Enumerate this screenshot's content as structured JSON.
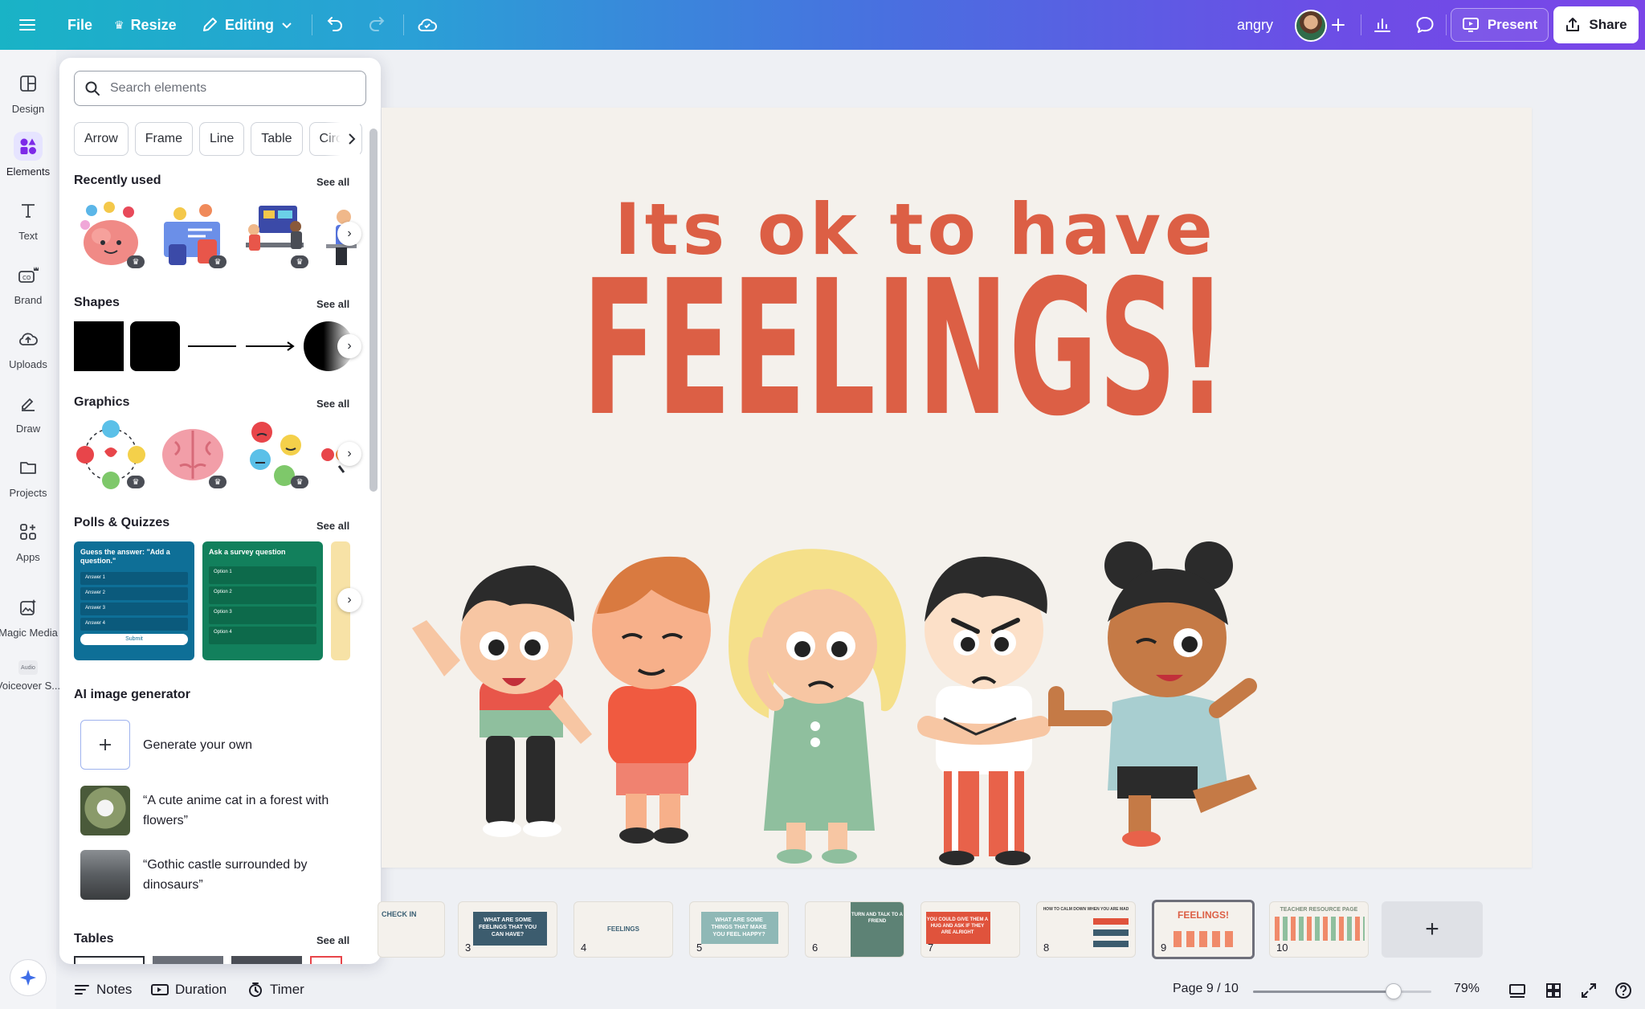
{
  "topbar": {
    "file_label": "File",
    "resize_label": "Resize",
    "editing_label": "Editing",
    "doc_title": "angry",
    "present_label": "Present",
    "share_label": "Share"
  },
  "rail": {
    "items": [
      {
        "label": "Design",
        "icon": "layout-icon"
      },
      {
        "label": "Elements",
        "icon": "elements-icon"
      },
      {
        "label": "Text",
        "icon": "text-icon"
      },
      {
        "label": "Brand",
        "icon": "brand-icon"
      },
      {
        "label": "Uploads",
        "icon": "upload-cloud-icon"
      },
      {
        "label": "Draw",
        "icon": "pen-icon"
      },
      {
        "label": "Projects",
        "icon": "folder-icon"
      },
      {
        "label": "Apps",
        "icon": "apps-icon"
      },
      {
        "label": "Magic Media",
        "icon": "magic-media-icon"
      },
      {
        "label": "Voiceover S...",
        "icon": "audio-icon",
        "badge": "Audio"
      }
    ]
  },
  "panel": {
    "search_placeholder": "Search elements",
    "chips": [
      "Arrow",
      "Frame",
      "Line",
      "Table",
      "Circle"
    ],
    "see_all": "See all",
    "recently_used_title": "Recently used",
    "shapes_title": "Shapes",
    "graphics_title": "Graphics",
    "polls_title": "Polls & Quizzes",
    "poll_quiz": {
      "question": "Guess the answer: \"Add a question.\"",
      "options": [
        "Answer 1",
        "Answer 2",
        "Answer 3",
        "Answer 4"
      ],
      "submit": "Submit"
    },
    "poll_survey": {
      "question": "Ask a survey question",
      "options": [
        "Option 1",
        "Option 2",
        "Option 3",
        "Option 4"
      ]
    },
    "ai_title": "AI image generator",
    "ai_generate": "Generate your own",
    "ai_prompt_1": "“A cute anime cat in a forest with flowers”",
    "ai_prompt_2": "“Gothic castle surrounded by dinosaurs”",
    "tables_title": "Tables"
  },
  "slide": {
    "subtitle": "Its ok to have",
    "title": "FEELINGS!",
    "accent_color": "#dc5f45",
    "background_color": "#f4f1ec"
  },
  "pages": [
    {
      "num": "",
      "text": "CHECK IN",
      "bg": "#f4f1ec",
      "fg": "#3a5f73"
    },
    {
      "num": "3",
      "text": "WHAT ARE SOME FEELINGS THAT YOU CAN HAVE?",
      "bg": "#3c5c6e",
      "fg": "#ffffff"
    },
    {
      "num": "4",
      "text": "FEELINGS",
      "bg": "#f4f1ec",
      "fg": "#3a5f73"
    },
    {
      "num": "5",
      "text": "WHAT ARE SOME THINGS THAT MAKE YOU FEEL HAPPY?",
      "bg": "#8fb8b6",
      "fg": "#ffffff"
    },
    {
      "num": "6",
      "text": "TURN AND TALK TO A FRIEND",
      "bg": "#5d8275",
      "fg": "#ffffff"
    },
    {
      "num": "7",
      "text": "YOU COULD GIVE THEM A HUG AND ASK IF THEY ARE ALRIGHT",
      "bg": "#e0533c",
      "fg": "#ffffff"
    },
    {
      "num": "8",
      "text": "HOW TO CALM DOWN WHEN YOU ARE MAD",
      "bg": "#f4f1ec",
      "fg": "#3a3a3a"
    },
    {
      "num": "9",
      "text": "FEELINGS!",
      "bg": "#f4f1ec",
      "fg": "#dc5f45"
    },
    {
      "num": "10",
      "text": "TEACHER RESOURCE PAGE",
      "bg": "#f4f1ec",
      "fg": "#7a8c7a"
    }
  ],
  "bottombar": {
    "notes_label": "Notes",
    "duration_label": "Duration",
    "timer_label": "Timer",
    "page_indicator": "Page 9 / 10",
    "zoom": "79%",
    "zoom_fraction": 0.79
  }
}
